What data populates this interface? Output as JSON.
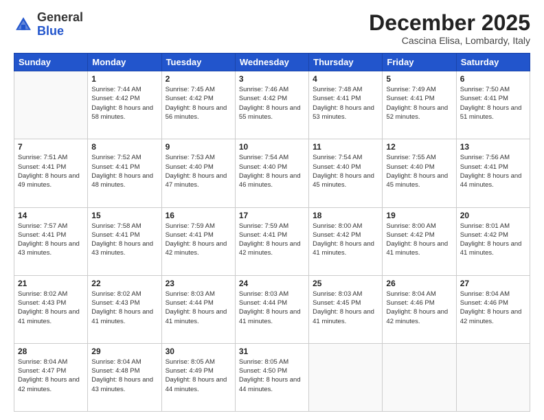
{
  "logo": {
    "general": "General",
    "blue": "Blue"
  },
  "header": {
    "month": "December 2025",
    "location": "Cascina Elisa, Lombardy, Italy"
  },
  "weekdays": [
    "Sunday",
    "Monday",
    "Tuesday",
    "Wednesday",
    "Thursday",
    "Friday",
    "Saturday"
  ],
  "weeks": [
    [
      {
        "day": "",
        "sunrise": "",
        "sunset": "",
        "daylight": ""
      },
      {
        "day": "1",
        "sunrise": "Sunrise: 7:44 AM",
        "sunset": "Sunset: 4:42 PM",
        "daylight": "Daylight: 8 hours and 58 minutes."
      },
      {
        "day": "2",
        "sunrise": "Sunrise: 7:45 AM",
        "sunset": "Sunset: 4:42 PM",
        "daylight": "Daylight: 8 hours and 56 minutes."
      },
      {
        "day": "3",
        "sunrise": "Sunrise: 7:46 AM",
        "sunset": "Sunset: 4:42 PM",
        "daylight": "Daylight: 8 hours and 55 minutes."
      },
      {
        "day": "4",
        "sunrise": "Sunrise: 7:48 AM",
        "sunset": "Sunset: 4:41 PM",
        "daylight": "Daylight: 8 hours and 53 minutes."
      },
      {
        "day": "5",
        "sunrise": "Sunrise: 7:49 AM",
        "sunset": "Sunset: 4:41 PM",
        "daylight": "Daylight: 8 hours and 52 minutes."
      },
      {
        "day": "6",
        "sunrise": "Sunrise: 7:50 AM",
        "sunset": "Sunset: 4:41 PM",
        "daylight": "Daylight: 8 hours and 51 minutes."
      }
    ],
    [
      {
        "day": "7",
        "sunrise": "Sunrise: 7:51 AM",
        "sunset": "Sunset: 4:41 PM",
        "daylight": "Daylight: 8 hours and 49 minutes."
      },
      {
        "day": "8",
        "sunrise": "Sunrise: 7:52 AM",
        "sunset": "Sunset: 4:41 PM",
        "daylight": "Daylight: 8 hours and 48 minutes."
      },
      {
        "day": "9",
        "sunrise": "Sunrise: 7:53 AM",
        "sunset": "Sunset: 4:40 PM",
        "daylight": "Daylight: 8 hours and 47 minutes."
      },
      {
        "day": "10",
        "sunrise": "Sunrise: 7:54 AM",
        "sunset": "Sunset: 4:40 PM",
        "daylight": "Daylight: 8 hours and 46 minutes."
      },
      {
        "day": "11",
        "sunrise": "Sunrise: 7:54 AM",
        "sunset": "Sunset: 4:40 PM",
        "daylight": "Daylight: 8 hours and 45 minutes."
      },
      {
        "day": "12",
        "sunrise": "Sunrise: 7:55 AM",
        "sunset": "Sunset: 4:40 PM",
        "daylight": "Daylight: 8 hours and 45 minutes."
      },
      {
        "day": "13",
        "sunrise": "Sunrise: 7:56 AM",
        "sunset": "Sunset: 4:41 PM",
        "daylight": "Daylight: 8 hours and 44 minutes."
      }
    ],
    [
      {
        "day": "14",
        "sunrise": "Sunrise: 7:57 AM",
        "sunset": "Sunset: 4:41 PM",
        "daylight": "Daylight: 8 hours and 43 minutes."
      },
      {
        "day": "15",
        "sunrise": "Sunrise: 7:58 AM",
        "sunset": "Sunset: 4:41 PM",
        "daylight": "Daylight: 8 hours and 43 minutes."
      },
      {
        "day": "16",
        "sunrise": "Sunrise: 7:59 AM",
        "sunset": "Sunset: 4:41 PM",
        "daylight": "Daylight: 8 hours and 42 minutes."
      },
      {
        "day": "17",
        "sunrise": "Sunrise: 7:59 AM",
        "sunset": "Sunset: 4:41 PM",
        "daylight": "Daylight: 8 hours and 42 minutes."
      },
      {
        "day": "18",
        "sunrise": "Sunrise: 8:00 AM",
        "sunset": "Sunset: 4:42 PM",
        "daylight": "Daylight: 8 hours and 41 minutes."
      },
      {
        "day": "19",
        "sunrise": "Sunrise: 8:00 AM",
        "sunset": "Sunset: 4:42 PM",
        "daylight": "Daylight: 8 hours and 41 minutes."
      },
      {
        "day": "20",
        "sunrise": "Sunrise: 8:01 AM",
        "sunset": "Sunset: 4:42 PM",
        "daylight": "Daylight: 8 hours and 41 minutes."
      }
    ],
    [
      {
        "day": "21",
        "sunrise": "Sunrise: 8:02 AM",
        "sunset": "Sunset: 4:43 PM",
        "daylight": "Daylight: 8 hours and 41 minutes."
      },
      {
        "day": "22",
        "sunrise": "Sunrise: 8:02 AM",
        "sunset": "Sunset: 4:43 PM",
        "daylight": "Daylight: 8 hours and 41 minutes."
      },
      {
        "day": "23",
        "sunrise": "Sunrise: 8:03 AM",
        "sunset": "Sunset: 4:44 PM",
        "daylight": "Daylight: 8 hours and 41 minutes."
      },
      {
        "day": "24",
        "sunrise": "Sunrise: 8:03 AM",
        "sunset": "Sunset: 4:44 PM",
        "daylight": "Daylight: 8 hours and 41 minutes."
      },
      {
        "day": "25",
        "sunrise": "Sunrise: 8:03 AM",
        "sunset": "Sunset: 4:45 PM",
        "daylight": "Daylight: 8 hours and 41 minutes."
      },
      {
        "day": "26",
        "sunrise": "Sunrise: 8:04 AM",
        "sunset": "Sunset: 4:46 PM",
        "daylight": "Daylight: 8 hours and 42 minutes."
      },
      {
        "day": "27",
        "sunrise": "Sunrise: 8:04 AM",
        "sunset": "Sunset: 4:46 PM",
        "daylight": "Daylight: 8 hours and 42 minutes."
      }
    ],
    [
      {
        "day": "28",
        "sunrise": "Sunrise: 8:04 AM",
        "sunset": "Sunset: 4:47 PM",
        "daylight": "Daylight: 8 hours and 42 minutes."
      },
      {
        "day": "29",
        "sunrise": "Sunrise: 8:04 AM",
        "sunset": "Sunset: 4:48 PM",
        "daylight": "Daylight: 8 hours and 43 minutes."
      },
      {
        "day": "30",
        "sunrise": "Sunrise: 8:05 AM",
        "sunset": "Sunset: 4:49 PM",
        "daylight": "Daylight: 8 hours and 44 minutes."
      },
      {
        "day": "31",
        "sunrise": "Sunrise: 8:05 AM",
        "sunset": "Sunset: 4:50 PM",
        "daylight": "Daylight: 8 hours and 44 minutes."
      },
      {
        "day": "",
        "sunrise": "",
        "sunset": "",
        "daylight": ""
      },
      {
        "day": "",
        "sunrise": "",
        "sunset": "",
        "daylight": ""
      },
      {
        "day": "",
        "sunrise": "",
        "sunset": "",
        "daylight": ""
      }
    ]
  ]
}
